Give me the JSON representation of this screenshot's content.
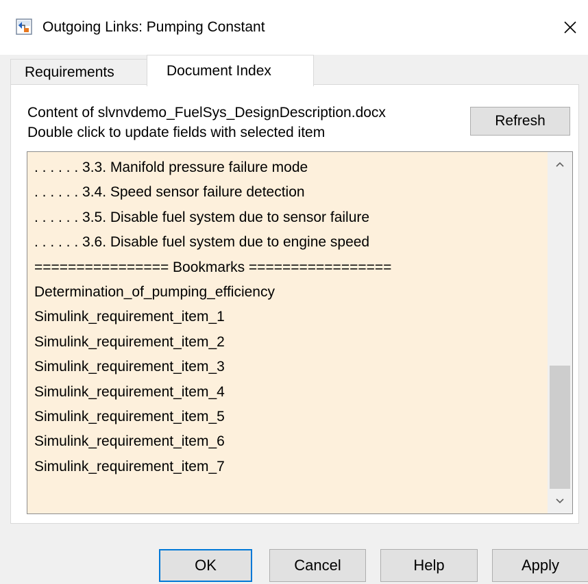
{
  "window": {
    "title": "Outgoing Links: Pumping Constant",
    "icon": "simulink-app-icon",
    "close_icon": "close-icon"
  },
  "tabs": [
    {
      "label": "Requirements",
      "selected": false
    },
    {
      "label": "Document Index",
      "selected": true
    }
  ],
  "panel": {
    "content_line": "Content of slvnvdemo_FuelSys_DesignDescription.docx",
    "instruction_line": "Double click to update fields with selected item",
    "refresh_label": "Refresh"
  },
  "list": {
    "items": [
      ". . . . . . 3.3. Manifold pressure failure mode",
      ". . . . . . 3.4. Speed sensor failure detection",
      ". . . . . . 3.5. Disable fuel system due to sensor failure",
      ". . . . . . 3.6. Disable fuel system due to engine speed",
      "================ Bookmarks =================",
      "Determination_of_pumping_efficiency",
      "Simulink_requirement_item_1",
      "Simulink_requirement_item_2",
      "Simulink_requirement_item_3",
      "Simulink_requirement_item_4",
      "Simulink_requirement_item_5",
      "Simulink_requirement_item_6",
      "Simulink_requirement_item_7"
    ],
    "background_color": "#fdf0dc"
  },
  "buttons": {
    "ok": "OK",
    "cancel": "Cancel",
    "help": "Help",
    "apply": "Apply"
  },
  "colors": {
    "default_button_border": "#0078d7",
    "window_background": "#f0f0f0"
  }
}
